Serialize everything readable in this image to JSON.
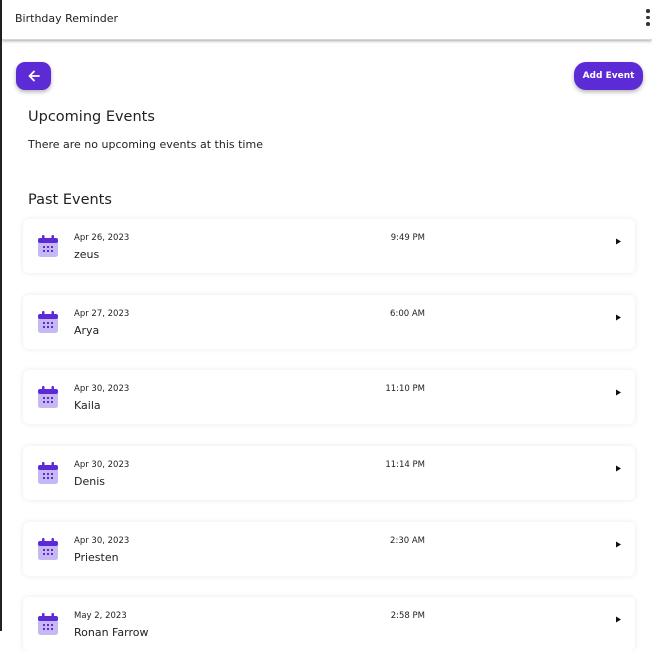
{
  "app": {
    "title": "Birthday Reminder"
  },
  "actions": {
    "add_event_label": "Add Event"
  },
  "upcoming": {
    "heading": "Upcoming Events",
    "empty_message": "There are no upcoming events at this time"
  },
  "past": {
    "heading": "Past Events",
    "events": [
      {
        "date": "Apr 26, 2023",
        "time": "9:49 PM",
        "name": "zeus"
      },
      {
        "date": "Apr 27, 2023",
        "time": "6:00 AM",
        "name": "Arya"
      },
      {
        "date": "Apr 30, 2023",
        "time": "11:10 PM",
        "name": "Kaila"
      },
      {
        "date": "Apr 30, 2023",
        "time": "11:14 PM",
        "name": "Denis"
      },
      {
        "date": "Apr 30, 2023",
        "time": "2:30 AM",
        "name": "Priesten"
      },
      {
        "date": "May 2, 2023",
        "time": "2:58 PM",
        "name": "Ronan Farrow"
      }
    ]
  },
  "colors": {
    "accent": "#5d2bd6",
    "icon_light": "#c6b8f2"
  },
  "icons": {
    "back": "arrow-left-icon",
    "menu": "more-vertical-icon",
    "event": "calendar-icon",
    "open": "play-arrow-icon"
  }
}
